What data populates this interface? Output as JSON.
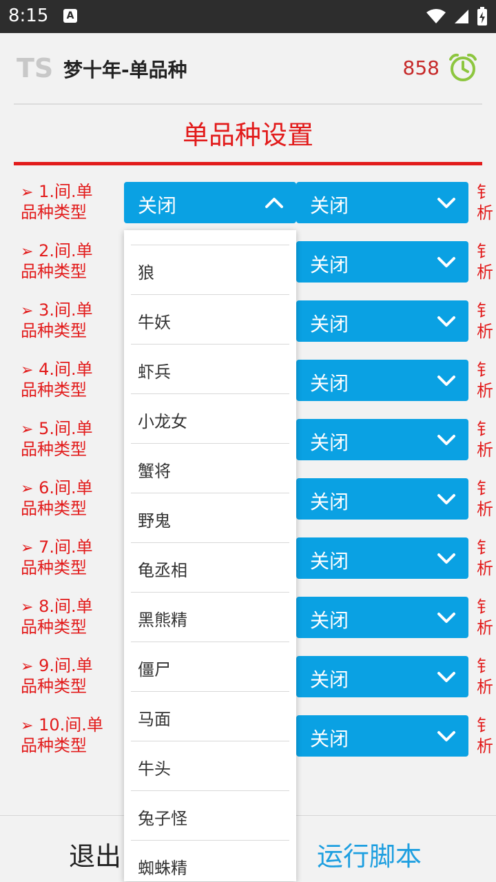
{
  "status_bar": {
    "time": "8:15",
    "notification_icon": "A"
  },
  "header": {
    "logo_text": "TS",
    "title": "梦十年-单品种",
    "counter": "858"
  },
  "section": {
    "title": "单品种设置"
  },
  "rows": [
    {
      "number_label": "1.间.单",
      "label_line2": "品种类型",
      "dropdown1": "关闭",
      "dropdown2": "关闭"
    },
    {
      "number_label": "2.间.单",
      "label_line2": "品种类型",
      "dropdown1": "关闭",
      "dropdown2": "关闭"
    },
    {
      "number_label": "3.间.单",
      "label_line2": "品种类型",
      "dropdown1": "关闭",
      "dropdown2": "关闭"
    },
    {
      "number_label": "4.间.单",
      "label_line2": "品种类型",
      "dropdown1": "关闭",
      "dropdown2": "关闭"
    },
    {
      "number_label": "5.间.单",
      "label_line2": "品种类型",
      "dropdown1": "关闭",
      "dropdown2": "关闭"
    },
    {
      "number_label": "6.间.单",
      "label_line2": "品种类型",
      "dropdown1": "关闭",
      "dropdown2": "关闭"
    },
    {
      "number_label": "7.间.单",
      "label_line2": "品种类型",
      "dropdown1": "关闭",
      "dropdown2": "关闭"
    },
    {
      "number_label": "8.间.单",
      "label_line2": "品种类型",
      "dropdown1": "关闭",
      "dropdown2": "关闭"
    },
    {
      "number_label": "9.间.单",
      "label_line2": "品种类型",
      "dropdown1": "关闭",
      "dropdown2": "关闭"
    },
    {
      "number_label": "10.间.单",
      "label_line2": "品种类型",
      "dropdown1": "关闭",
      "dropdown2": "关闭"
    }
  ],
  "clipped_right_text": [
    "钅",
    "析"
  ],
  "dropdown_options": [
    "狼",
    "牛妖",
    "虾兵",
    "小龙女",
    "蟹将",
    "野鬼",
    "龟丞相",
    "黑熊精",
    "僵尸",
    "马面",
    "牛头",
    "兔子怪",
    "蜘蛛精"
  ],
  "footer": {
    "exit_label": "退出",
    "run_label": "运行脚本"
  },
  "colors": {
    "accent_red": "#e21b1b",
    "dropdown_blue": "#0aa1e3",
    "run_blue": "#1e9fe0",
    "alarm_green": "#8dc63f"
  },
  "icons": [
    "arrow-right-icon",
    "chevron-up-icon",
    "chevron-down-icon",
    "alarm-clock-icon",
    "wifi-icon",
    "signal-icon",
    "battery-icon"
  ]
}
